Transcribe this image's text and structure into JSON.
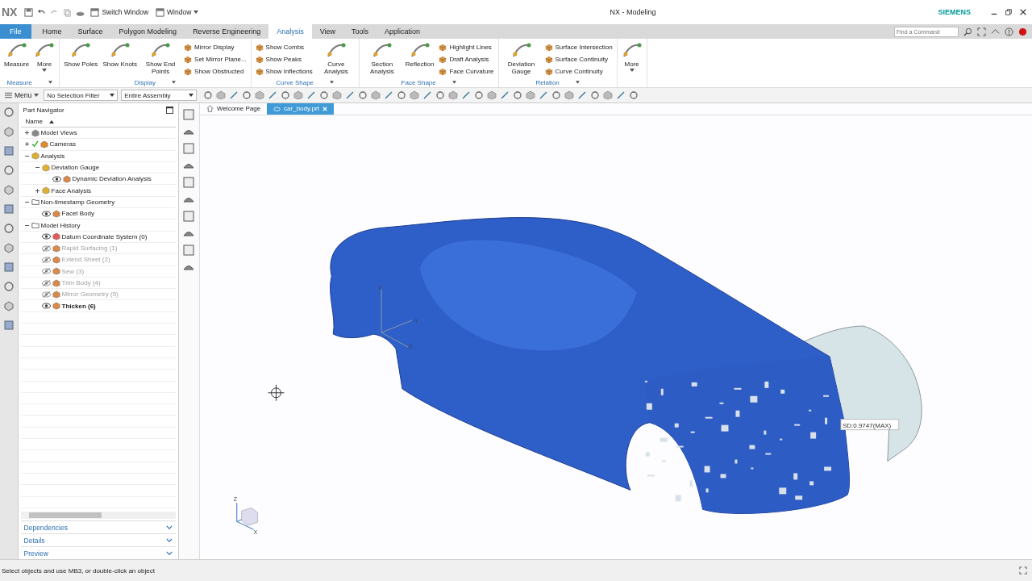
{
  "window": {
    "logo": "NX",
    "title": "NX - Modeling",
    "brand": "SIEMENS"
  },
  "quick_access": [
    {
      "label": "Switch Window",
      "dropdown": false
    },
    {
      "label": "Window",
      "dropdown": true
    }
  ],
  "ribbon_tabs": [
    {
      "label": "File",
      "kind": "file",
      "selected": false
    },
    {
      "label": "Home",
      "kind": "tab",
      "selected": false
    },
    {
      "label": "Surface",
      "kind": "tab",
      "selected": false
    },
    {
      "label": "Polygon Modeling",
      "kind": "tab",
      "selected": false
    },
    {
      "label": "Reverse Engineering",
      "kind": "tab",
      "selected": false
    },
    {
      "label": "Analysis",
      "kind": "tab",
      "selected": true
    },
    {
      "label": "View",
      "kind": "tab",
      "selected": false
    },
    {
      "label": "Tools",
      "kind": "tab",
      "selected": false
    },
    {
      "label": "Application",
      "kind": "tab",
      "selected": false
    }
  ],
  "find_command": {
    "placeholder": "Find a Command"
  },
  "ribbon_groups": [
    {
      "label": "Measure",
      "items": [
        {
          "kind": "large",
          "label": "Measure",
          "dropdown": false
        },
        {
          "kind": "large",
          "label": "More",
          "dropdown": true
        }
      ]
    },
    {
      "label": "Display",
      "items": [
        {
          "kind": "large",
          "label": "Show Poles",
          "dropdown": false
        },
        {
          "kind": "large",
          "label": "Show Knots",
          "dropdown": false
        },
        {
          "kind": "large",
          "label": "Show End Points",
          "dropdown": false
        },
        {
          "kind": "stack",
          "labels": [
            "Mirror Display",
            "Set Mirror Plane...",
            "Show Obstructed"
          ]
        }
      ]
    },
    {
      "label": "Curve Shape",
      "items": [
        {
          "kind": "stack",
          "labels": [
            "Show Combs",
            "Show Peaks",
            "Show Inflections"
          ]
        },
        {
          "kind": "large",
          "label": "Curve Analysis",
          "dropdown": false
        }
      ]
    },
    {
      "label": "Face Shape",
      "items": [
        {
          "kind": "large",
          "label": "Section Analysis",
          "dropdown": false
        },
        {
          "kind": "large",
          "label": "Reflection",
          "dropdown": false
        },
        {
          "kind": "stack",
          "labels": [
            "Highlight Lines",
            "Draft Analysis",
            "Face Curvature"
          ]
        }
      ]
    },
    {
      "label": "Relation",
      "items": [
        {
          "kind": "large",
          "label": "Deviation Gauge",
          "dropdown": false
        },
        {
          "kind": "stack",
          "labels": [
            "Surface Intersection",
            "Surface Continuity",
            "Curve Continuity"
          ]
        }
      ]
    },
    {
      "items": [
        {
          "kind": "large",
          "label": "More",
          "dropdown": true
        }
      ]
    }
  ],
  "toolbar": {
    "menu": "Menu",
    "selection_filter": "No Selection Filter",
    "scope": "Entire Assembly"
  },
  "navigator": {
    "title": "Part Navigator",
    "column": "Name",
    "tree": [
      {
        "label": "Model Views",
        "kind": "views",
        "expanded": false
      },
      {
        "label": "Cameras",
        "kind": "camera",
        "expanded": false,
        "checked": true
      },
      {
        "label": "Analysis",
        "kind": "analysis",
        "expanded": true,
        "children": [
          {
            "label": "Deviation Gauge",
            "kind": "analysis",
            "expanded": true,
            "children": [
              {
                "label": "Dynamic Deviation Analysis",
                "kind": "feature",
                "visible": true
              }
            ]
          },
          {
            "label": "Face Analysis",
            "kind": "analysis",
            "expanded": false
          }
        ]
      },
      {
        "label": "Non-timestamp Geometry",
        "kind": "folder",
        "expanded": true,
        "children": [
          {
            "label": "Facet Body",
            "kind": "feature",
            "visible": true
          }
        ]
      },
      {
        "label": "Model History",
        "kind": "folder",
        "expanded": true,
        "children": [
          {
            "label": "Datum Coordinate System (0)",
            "kind": "datum",
            "visible": true,
            "dimmed": false,
            "current": false
          },
          {
            "label": "Rapid Surfacing (1)",
            "kind": "feature",
            "visible": false,
            "dimmed": true,
            "current": false
          },
          {
            "label": "Extend Sheet (2)",
            "kind": "feature",
            "visible": false,
            "dimmed": true,
            "current": false
          },
          {
            "label": "Sew (3)",
            "kind": "feature",
            "visible": false,
            "dimmed": true,
            "current": false
          },
          {
            "label": "Trim Body (4)",
            "kind": "feature",
            "visible": false,
            "dimmed": true,
            "current": false
          },
          {
            "label": "Mirror Geometry (5)",
            "kind": "feature",
            "visible": false,
            "dimmed": true,
            "current": false
          },
          {
            "label": "Thicken (6)",
            "kind": "feature",
            "visible": true,
            "dimmed": false,
            "current": true
          }
        ]
      }
    ],
    "panels": [
      {
        "label": "Dependencies",
        "expanded": false
      },
      {
        "label": "Details",
        "expanded": false
      },
      {
        "label": "Preview",
        "expanded": false
      }
    ]
  },
  "document_tabs": [
    {
      "label": "Welcome Page",
      "kind": "home",
      "selected": false
    },
    {
      "label": "car_body.prt",
      "kind": "part",
      "selected": true
    }
  ],
  "viewport": {
    "datum_labels": [
      "Z",
      "Y",
      "X"
    ],
    "view_triad_labels": [
      "Z",
      "X"
    ],
    "deviation_label": "SD:0.9747(MAX)"
  },
  "status_bar": {
    "prompt": "Select objects and use MB3, or double-click an object"
  }
}
